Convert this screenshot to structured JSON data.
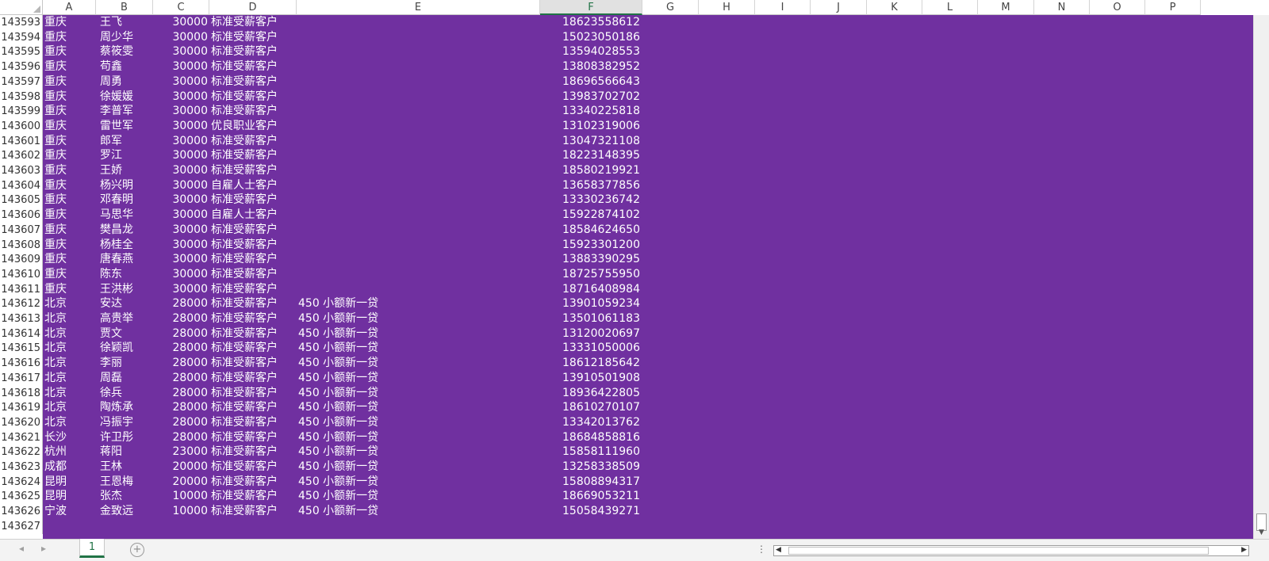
{
  "app": {
    "name": "Excel"
  },
  "columns": [
    "A",
    "B",
    "C",
    "D",
    "E",
    "F",
    "G",
    "H",
    "I",
    "J",
    "K",
    "L",
    "M",
    "N",
    "O",
    "P"
  ],
  "selected_column": "F",
  "fill_color": "#7030a0",
  "text_color": "#ffffff",
  "rows": [
    {
      "n": "143593",
      "a": "重庆",
      "b": "王飞",
      "c": "30000",
      "d": "标准受薪客户",
      "e": "",
      "f": "18623558612"
    },
    {
      "n": "143594",
      "a": "重庆",
      "b": "周少华",
      "c": "30000",
      "d": "标准受薪客户",
      "e": "",
      "f": "15023050186"
    },
    {
      "n": "143595",
      "a": "重庆",
      "b": "蔡筱雯",
      "c": "30000",
      "d": "标准受薪客户",
      "e": "",
      "f": "13594028553"
    },
    {
      "n": "143596",
      "a": "重庆",
      "b": "苟鑫",
      "c": "30000",
      "d": "标准受薪客户",
      "e": "",
      "f": "13808382952"
    },
    {
      "n": "143597",
      "a": "重庆",
      "b": "周勇",
      "c": "30000",
      "d": "标准受薪客户",
      "e": "",
      "f": "18696566643"
    },
    {
      "n": "143598",
      "a": "重庆",
      "b": "徐媛媛",
      "c": "30000",
      "d": "标准受薪客户",
      "e": "",
      "f": "13983702702"
    },
    {
      "n": "143599",
      "a": "重庆",
      "b": "李普军",
      "c": "30000",
      "d": "标准受薪客户",
      "e": "",
      "f": "13340225818"
    },
    {
      "n": "143600",
      "a": "重庆",
      "b": "雷世军",
      "c": "30000",
      "d": "优良职业客户",
      "e": "",
      "f": "13102319006"
    },
    {
      "n": "143601",
      "a": "重庆",
      "b": "郎军",
      "c": "30000",
      "d": "标准受薪客户",
      "e": "",
      "f": "13047321108"
    },
    {
      "n": "143602",
      "a": "重庆",
      "b": "罗江",
      "c": "30000",
      "d": "标准受薪客户",
      "e": "",
      "f": "18223148395"
    },
    {
      "n": "143603",
      "a": "重庆",
      "b": "王娇",
      "c": "30000",
      "d": "标准受薪客户",
      "e": "",
      "f": "18580219921"
    },
    {
      "n": "143604",
      "a": "重庆",
      "b": "杨兴明",
      "c": "30000",
      "d": "自雇人士客户",
      "e": "",
      "f": "13658377856"
    },
    {
      "n": "143605",
      "a": "重庆",
      "b": "邓春明",
      "c": "30000",
      "d": "标准受薪客户",
      "e": "",
      "f": "13330236742"
    },
    {
      "n": "143606",
      "a": "重庆",
      "b": "马思华",
      "c": "30000",
      "d": "自雇人士客户",
      "e": "",
      "f": "15922874102"
    },
    {
      "n": "143607",
      "a": "重庆",
      "b": "樊昌龙",
      "c": "30000",
      "d": "标准受薪客户",
      "e": "",
      "f": "18584624650"
    },
    {
      "n": "143608",
      "a": "重庆",
      "b": "杨桂全",
      "c": "30000",
      "d": "标准受薪客户",
      "e": "",
      "f": "15923301200"
    },
    {
      "n": "143609",
      "a": "重庆",
      "b": "唐春燕",
      "c": "30000",
      "d": "标准受薪客户",
      "e": "",
      "f": "13883390295"
    },
    {
      "n": "143610",
      "a": "重庆",
      "b": "陈东",
      "c": "30000",
      "d": "标准受薪客户",
      "e": "",
      "f": "18725755950"
    },
    {
      "n": "143611",
      "a": "重庆",
      "b": "王洪彬",
      "c": "30000",
      "d": "标准受薪客户",
      "e": "",
      "f": "18716408984"
    },
    {
      "n": "143612",
      "a": "北京",
      "b": "安达",
      "c": "28000",
      "d": "标准受薪客户",
      "e": "450 小额新一贷",
      "f": "13901059234"
    },
    {
      "n": "143613",
      "a": "北京",
      "b": "高贵举",
      "c": "28000",
      "d": "标准受薪客户",
      "e": "450 小额新一贷",
      "f": "13501061183"
    },
    {
      "n": "143614",
      "a": "北京",
      "b": "贾文",
      "c": "28000",
      "d": "标准受薪客户",
      "e": "450 小额新一贷",
      "f": "13120020697"
    },
    {
      "n": "143615",
      "a": "北京",
      "b": "徐颖凯",
      "c": "28000",
      "d": "标准受薪客户",
      "e": "450 小额新一贷",
      "f": "13331050006"
    },
    {
      "n": "143616",
      "a": "北京",
      "b": "李丽",
      "c": "28000",
      "d": "标准受薪客户",
      "e": "450 小额新一贷",
      "f": "18612185642"
    },
    {
      "n": "143617",
      "a": "北京",
      "b": "周磊",
      "c": "28000",
      "d": "标准受薪客户",
      "e": "450 小额新一贷",
      "f": "13910501908"
    },
    {
      "n": "143618",
      "a": "北京",
      "b": "徐兵",
      "c": "28000",
      "d": "标准受薪客户",
      "e": "450 小额新一贷",
      "f": "18936422805"
    },
    {
      "n": "143619",
      "a": "北京",
      "b": "陶炼承",
      "c": "28000",
      "d": "标准受薪客户",
      "e": "450 小额新一贷",
      "f": "18610270107"
    },
    {
      "n": "143620",
      "a": "北京",
      "b": "冯振宇",
      "c": "28000",
      "d": "标准受薪客户",
      "e": "450 小额新一贷",
      "f": "13342013762"
    },
    {
      "n": "143621",
      "a": "长沙",
      "b": "许卫彤",
      "c": "28000",
      "d": "标准受薪客户",
      "e": "450 小额新一贷",
      "f": "18684858816"
    },
    {
      "n": "143622",
      "a": "杭州",
      "b": "蒋阳",
      "c": "23000",
      "d": "标准受薪客户",
      "e": "450 小额新一贷",
      "f": "15858111960"
    },
    {
      "n": "143623",
      "a": "成都",
      "b": "王林",
      "c": "20000",
      "d": "标准受薪客户",
      "e": "450 小额新一贷",
      "f": "13258338509"
    },
    {
      "n": "143624",
      "a": "昆明",
      "b": "王恩梅",
      "c": "20000",
      "d": "标准受薪客户",
      "e": "450 小额新一贷",
      "f": "15808894317"
    },
    {
      "n": "143625",
      "a": "昆明",
      "b": "张杰",
      "c": "10000",
      "d": "标准受薪客户",
      "e": "450 小额新一贷",
      "f": "18669053211"
    },
    {
      "n": "143626",
      "a": "宁波",
      "b": "金致远",
      "c": "10000",
      "d": "标准受薪客户",
      "e": "450 小额新一贷",
      "f": "15058439271"
    },
    {
      "n": "143627",
      "a": "",
      "b": "",
      "c": "",
      "d": "",
      "e": "",
      "f": ""
    }
  ],
  "sheet_tabs": [
    {
      "label": "1",
      "active": true
    }
  ],
  "status": {
    "add_sheet_label": "+",
    "options_glyph": "⋮"
  },
  "icons": {
    "nav_prev": "◂",
    "nav_next": "▸",
    "scroll_left": "◀",
    "scroll_right": "▶",
    "scroll_down": "▼"
  }
}
